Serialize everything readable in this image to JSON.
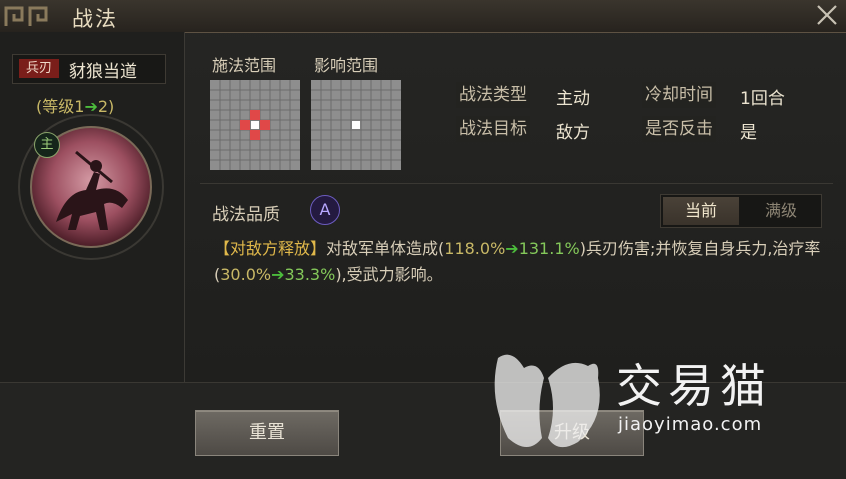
{
  "window": {
    "title": "战法"
  },
  "skill": {
    "weapon_tag": "兵刃",
    "name": "豺狼当道",
    "level_prefix": "(等级1",
    "level_suffix": "2)",
    "main_tag": "主"
  },
  "grids": {
    "cast_label": "施法范围",
    "effect_label": "影响范围"
  },
  "info": {
    "type_label": "战法类型",
    "type_value": "主动",
    "cooldown_label": "冷却时间",
    "cooldown_value": "1回合",
    "target_label": "战法目标",
    "target_value": "敌方",
    "counter_label": "是否反击",
    "counter_value": "是"
  },
  "quality": {
    "label": "战法品质",
    "grade": "A"
  },
  "toggle": {
    "current": "当前",
    "max": "满级"
  },
  "description": {
    "tag": "【对敌方释放】",
    "p1": "对敌军单体造成(",
    "dmg_old": "118.0%",
    "dmg_new": "131.1%",
    "p2": ")兵刃伤害;并恢复自身兵力,治疗率(",
    "heal_old": "30.0%",
    "heal_new": "33.3%",
    "p3": "),受武力影响。"
  },
  "buttons": {
    "reset": "重置",
    "upgrade": "升级"
  },
  "watermark": {
    "brand": "交易猫",
    "url": "jiaoyimao.com"
  },
  "colors": {
    "accent_red": "#e04848",
    "green_arrow": "#4cbc3c",
    "quality_purple": "#6c5cc0"
  }
}
